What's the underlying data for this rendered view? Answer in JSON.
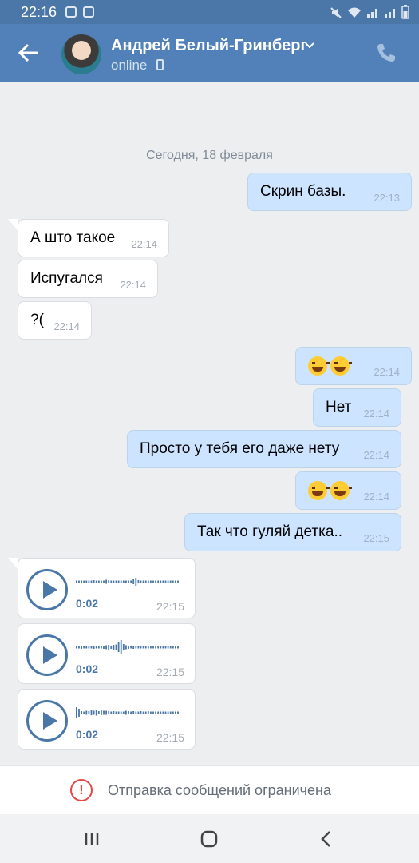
{
  "status_bar": {
    "time": "22:16"
  },
  "header": {
    "contact_name": "Андрей Белый-Гринберг",
    "status": "online"
  },
  "chat": {
    "date_separator": "Сегодня, 18 февраля",
    "messages": [
      {
        "direction": "out",
        "text": "Скрин базы.",
        "time": "22:13"
      },
      {
        "direction": "in",
        "text": "А што такое",
        "time": "22:14"
      },
      {
        "direction": "in",
        "text": "Испугался",
        "time": "22:14"
      },
      {
        "direction": "in",
        "text": "?(",
        "time": "22:14"
      },
      {
        "direction": "out",
        "emoji": [
          "rofl-emoji",
          "rofl-emoji"
        ],
        "time": "22:14"
      },
      {
        "direction": "out",
        "text": "Нет",
        "time": "22:14"
      },
      {
        "direction": "out",
        "text": "Просто у тебя его даже нету",
        "time": "22:14"
      },
      {
        "direction": "out",
        "emoji": [
          "joy-emoji",
          "joy-emoji"
        ],
        "time": "22:14"
      },
      {
        "direction": "out",
        "text": "Так что гуляй детка..",
        "time": "22:15"
      }
    ],
    "voice_messages": [
      {
        "duration": "0:02",
        "time": "22:15"
      },
      {
        "duration": "0:02",
        "time": "22:15"
      },
      {
        "duration": "0:02",
        "time": "22:15"
      }
    ]
  },
  "restriction": {
    "icon": "alert-circle-icon",
    "text": "Отправка сообщений ограничена"
  },
  "nav_bar": {
    "buttons": [
      "recent-apps-icon",
      "home-icon",
      "back-nav-icon"
    ]
  },
  "colors": {
    "header": "#5181b8",
    "status_bar": "#4a76a8",
    "outgoing_bubble": "#cce4ff",
    "incoming_bubble": "#ffffff",
    "chat_background": "#edeef0",
    "alert": "#e64646"
  }
}
